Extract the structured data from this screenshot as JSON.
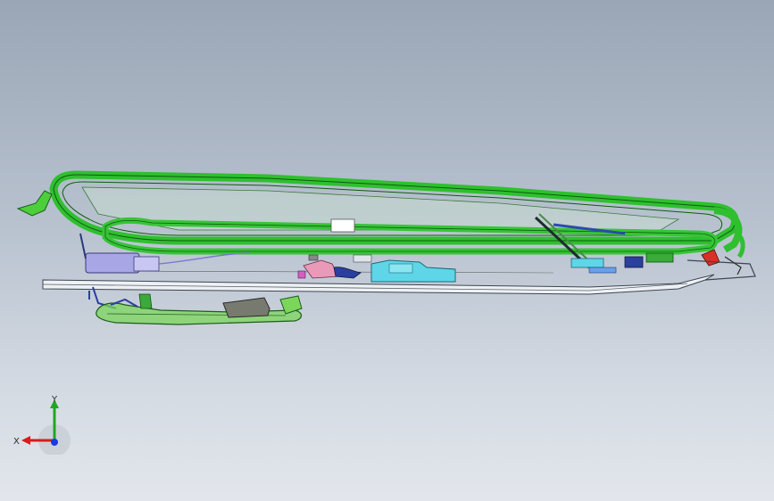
{
  "viewport": {
    "background_top": "#9aa6b6",
    "background_bottom": "#e2e6ec"
  },
  "model": {
    "frame_color": "#2fbf2f",
    "frame_edge_color": "#116611",
    "rail_color": "#e8ecf0",
    "bracket_color": "#7bd65a",
    "components": [
      {
        "name": "cyan-housing",
        "color": "#5fd6e8"
      },
      {
        "name": "pink-bracket",
        "color": "#e99ab8"
      },
      {
        "name": "blue-motor",
        "color": "#2a3f9e"
      },
      {
        "name": "lavender-block",
        "color": "#a9a6e6"
      },
      {
        "name": "red-clip",
        "color": "#d9302a"
      }
    ]
  },
  "triad": {
    "x_label": "X",
    "y_label": "Y",
    "x_color": "#d81b1b",
    "y_color": "#1fa81f",
    "z_color": "#1b3cd8"
  }
}
